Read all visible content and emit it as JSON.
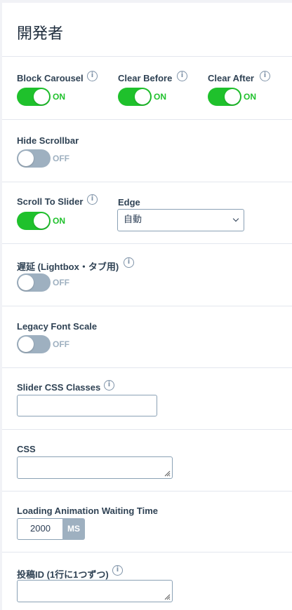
{
  "section_title": "開発者",
  "rows": {
    "block_carousel": {
      "label": "Block Carousel",
      "state": "ON"
    },
    "clear_before": {
      "label": "Clear Before",
      "state": "ON"
    },
    "clear_after": {
      "label": "Clear After",
      "state": "ON"
    },
    "hide_scrollbar": {
      "label": "Hide Scrollbar",
      "state": "OFF"
    },
    "scroll_to_slider": {
      "label": "Scroll To Slider",
      "state": "ON"
    },
    "edge": {
      "label": "Edge",
      "value": "自動"
    },
    "delay_lightbox": {
      "label": "遅延 (Lightbox・タブ用)",
      "state": "OFF"
    },
    "legacy_font_scale": {
      "label": "Legacy Font Scale",
      "state": "OFF"
    },
    "slider_css_classes": {
      "label": "Slider CSS Classes",
      "value": ""
    },
    "css": {
      "label": "CSS",
      "value": ""
    },
    "loading_animation": {
      "label": "Loading Animation Waiting Time",
      "value": "2000",
      "unit": "MS"
    },
    "post_ids": {
      "label": "投稿ID (1行に1つずつ)",
      "value": ""
    }
  },
  "info_glyph": "i",
  "colors": {
    "on": "#1fc12c",
    "off": "#9eb0c0",
    "border": "#8aa1b5"
  }
}
